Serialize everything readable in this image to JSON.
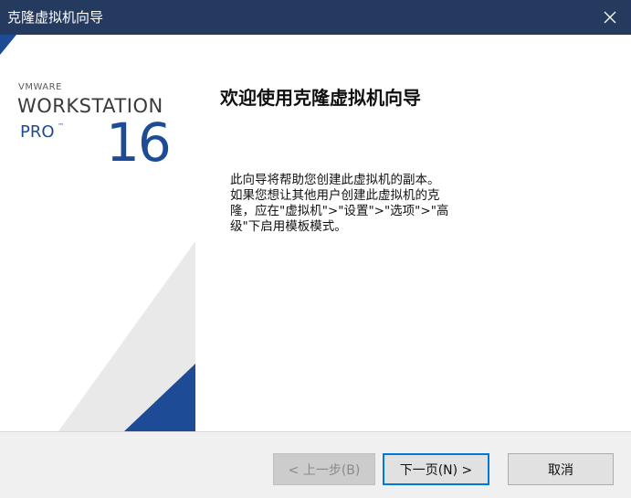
{
  "window": {
    "title": "克隆虚拟机向导",
    "close_icon": "close-icon"
  },
  "brand": {
    "vendor": "VMWARE",
    "product": "WORKSTATION",
    "edition": "PRO",
    "trademark": "™",
    "version": "16",
    "colors": {
      "blue": "#1e4b95",
      "gray": "#e8e8e8"
    }
  },
  "content": {
    "heading": "欢迎使用克隆虚拟机向导",
    "paragraph_lines": [
      "此向导将帮助您创建此虚拟机的副本。",
      "如果您想让其他用户创建此虚拟机的克",
      "隆，应在\"虚拟机\">\"设置\">\"选项\">\"高",
      "级\"下启用模板模式。"
    ]
  },
  "buttons": {
    "back": "< 上一步(B)",
    "next": "下一页(N) >",
    "cancel": "取消"
  },
  "colors": {
    "titlebar": "#243a5e",
    "accent": "#0078d7"
  }
}
